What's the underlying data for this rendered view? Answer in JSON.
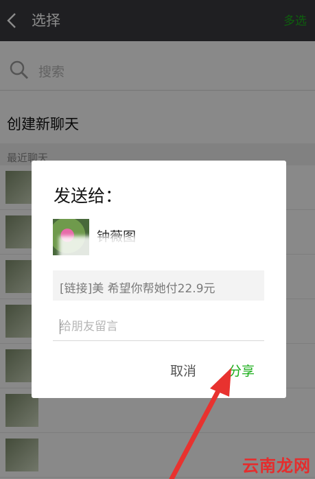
{
  "header": {
    "title": "选择",
    "multi_select": "多选"
  },
  "search": {
    "placeholder": "搜索"
  },
  "new_chat": {
    "label": "创建新聊天"
  },
  "recent": {
    "section_label": "最近聊天"
  },
  "dialog": {
    "title": "发送给：",
    "recipient_name": "钟薇图",
    "message_preview": "[链接]美    希望你帮她付22.9元",
    "comment_placeholder": "给朋友留言",
    "cancel_label": "取消",
    "share_label": "分享"
  },
  "watermark": "云南龙网",
  "colors": {
    "accent": "#1aad19",
    "topbar": "#393a3f",
    "arrow": "#e8322f"
  }
}
